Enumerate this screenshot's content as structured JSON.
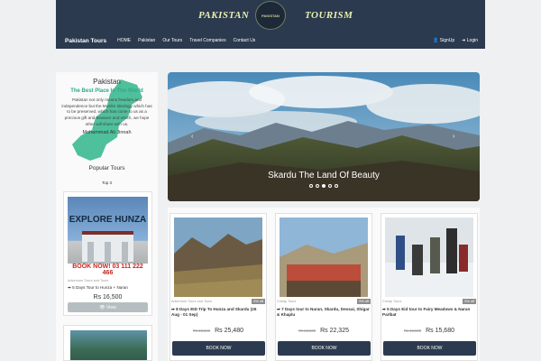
{
  "header": {
    "brand_left": "PAKISTAN",
    "brand_right": "TOURISM",
    "logo_text": "PAKISTAN"
  },
  "nav": {
    "site": "Pakistan Tours",
    "links": [
      "HOME",
      "Pakistan",
      "Our Tours",
      "Travel Companies",
      "Contact Us"
    ],
    "signup": "SignUp",
    "login": "Login"
  },
  "quote": {
    "title": "Pakistan",
    "subtitle": "The Best Place In The World",
    "body": "Pakistan not only means freedom and independence but the Muslim Ideology which has to be preserved, which has come to us as a precious gift and treasure and which, we hope other will share with us.",
    "author": "Mohammad Ali Jinnah"
  },
  "popular": {
    "title": "Popular Tours",
    "subtitle": "Top 3",
    "card": {
      "headline": "EXPLORE HUNZA",
      "phone": "BOOK NOW! 03 111 222 466",
      "category": "Adventure Tours and Tours",
      "name": "5 Days Tour to Hunza + Naran",
      "price": "Rs 16,500",
      "button": "View"
    }
  },
  "slider": {
    "caption": "Skardu The Land Of Beauty",
    "slides": 5,
    "active": 3
  },
  "tours": [
    {
      "category": "Adventure Tours and Tours",
      "badge": "5% off",
      "name": "8 Days EID Trip To Hunza and Skardu (26 Aug - 01 Sep)",
      "old_price": "Rs 26,840",
      "price": "Rs 25,480",
      "button": "BOOK NOW"
    },
    {
      "category": "Cheap Tours",
      "badge": "5% off",
      "name": "7 Days tour to Naran, Skardu, Deosai, Shigar & Khaplu",
      "old_price": "Rs 23,500",
      "price": "Rs 22,325",
      "button": "BOOK NOW"
    },
    {
      "category": "Cheap Tours",
      "badge": "5% off",
      "name": "5 Days Eid tour to Fairy Meadows & Naran Parlbat",
      "old_price": "Rs 16,500",
      "price": "Rs 15,680",
      "button": "BOOK NOW"
    }
  ],
  "colors": {
    "navy": "#2c3a4f",
    "accent_green": "#2fa98c"
  }
}
